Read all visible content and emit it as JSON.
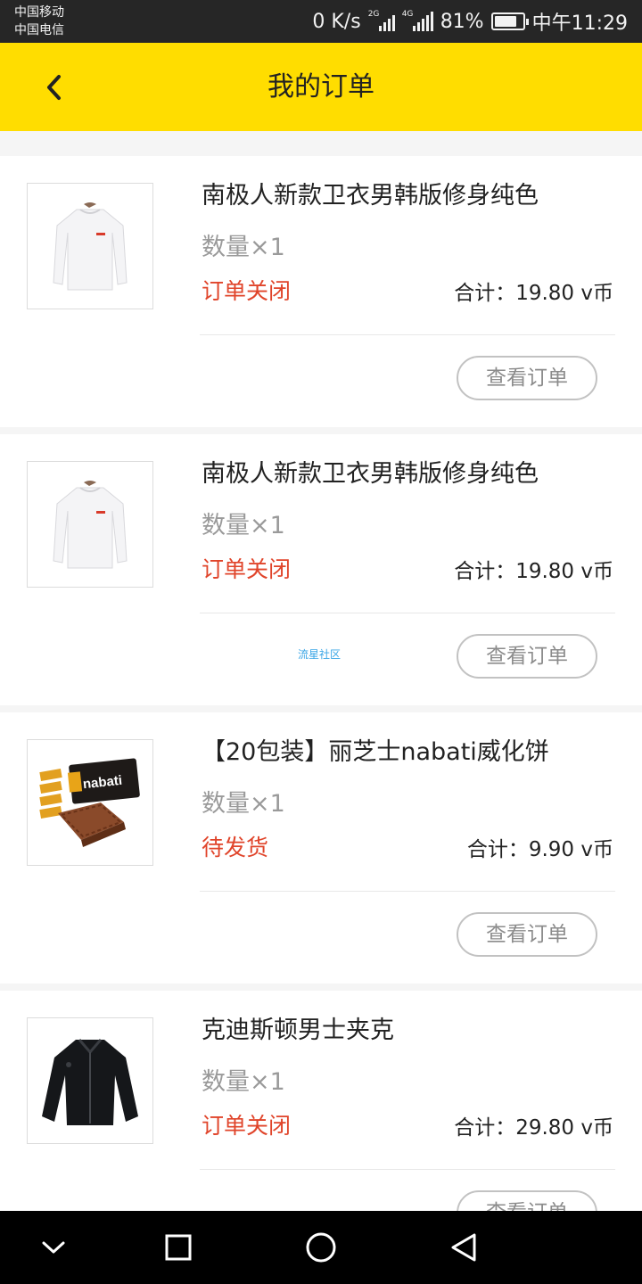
{
  "status_bar": {
    "carrier1": "中国移动",
    "carrier2": "中国电信",
    "net_speed": "0 K/s",
    "sim1_tag": "2G",
    "sim2_tag": "4G",
    "battery": "81%",
    "battery_level": 0.81,
    "time": "中午11:29"
  },
  "header": {
    "title": "我的订单",
    "back_icon": "chevron-left-icon",
    "background": "#ffdd00"
  },
  "orders": [
    {
      "title": "南极人新款卫衣男韩版修身纯色",
      "quantity": "数量×1",
      "status": "订单关闭",
      "total": "合计：19.80 v币",
      "button": "查看订单",
      "image": "white-sweatshirt"
    },
    {
      "title": "南极人新款卫衣男韩版修身纯色",
      "quantity": "数量×1",
      "status": "订单关闭",
      "total": "合计：19.80 v币",
      "button": "查看订单",
      "image": "white-sweatshirt",
      "watermark": "流星社区"
    },
    {
      "title": "【20包装】丽芝士nabati威化饼",
      "quantity": "数量×1",
      "status": "待发货",
      "total": "合计：9.90 v币",
      "button": "查看订单",
      "image": "nabati-wafer-pack",
      "brand_text": "nabati"
    },
    {
      "title": "克迪斯顿男士夹克",
      "quantity": "数量×1",
      "status": "订单关闭",
      "total": "合计：29.80 v币",
      "button": "查看订单",
      "image": "black-jacket"
    }
  ],
  "colors": {
    "accent": "#ffdd00",
    "status_red": "#e0442a",
    "muted": "#9a9a9a"
  },
  "nav_bar": {
    "icons": [
      "chevron-down-icon",
      "square-icon",
      "circle-icon",
      "triangle-back-icon"
    ]
  }
}
